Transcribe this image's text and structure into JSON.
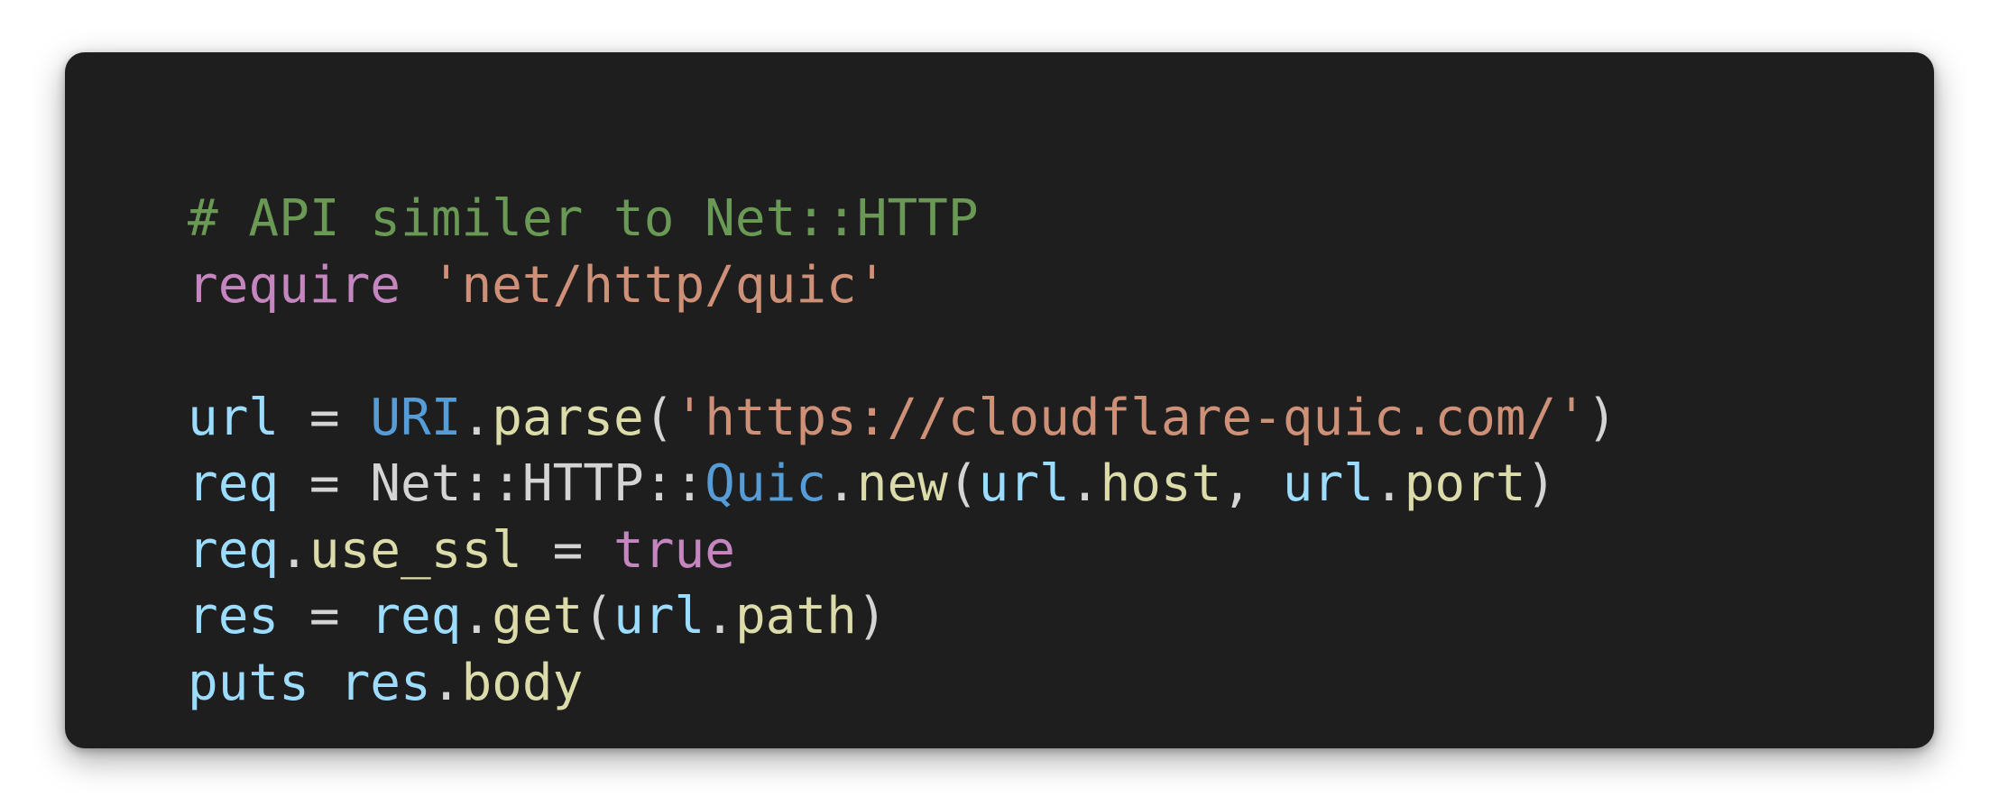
{
  "code": {
    "line1": [
      {
        "text": "# API similer to Net::HTTP",
        "color": "#6a9955"
      }
    ],
    "line2": [
      {
        "text": "require",
        "color": "#c586c0"
      },
      {
        "text": " ",
        "color": "#d4d4d4"
      },
      {
        "text": "'net/http/quic'",
        "color": "#ce9178"
      }
    ],
    "line3": [],
    "line4": [
      {
        "text": "url",
        "color": "#9cdcfe"
      },
      {
        "text": " = ",
        "color": "#d4d4d4"
      },
      {
        "text": "URI",
        "color": "#569cd6"
      },
      {
        "text": ".",
        "color": "#d4d4d4"
      },
      {
        "text": "parse",
        "color": "#dcdcaa"
      },
      {
        "text": "(",
        "color": "#d4d4d4"
      },
      {
        "text": "'https://cloudflare-quic.com/'",
        "color": "#ce9178"
      },
      {
        "text": ")",
        "color": "#d4d4d4"
      }
    ],
    "line5": [
      {
        "text": "req",
        "color": "#9cdcfe"
      },
      {
        "text": " = Net::HTTP::",
        "color": "#d4d4d4"
      },
      {
        "text": "Quic",
        "color": "#569cd6"
      },
      {
        "text": ".",
        "color": "#d4d4d4"
      },
      {
        "text": "new",
        "color": "#dcdcaa"
      },
      {
        "text": "(",
        "color": "#d4d4d4"
      },
      {
        "text": "url",
        "color": "#9cdcfe"
      },
      {
        "text": ".",
        "color": "#d4d4d4"
      },
      {
        "text": "host",
        "color": "#dcdcaa"
      },
      {
        "text": ", ",
        "color": "#d4d4d4"
      },
      {
        "text": "url",
        "color": "#9cdcfe"
      },
      {
        "text": ".",
        "color": "#d4d4d4"
      },
      {
        "text": "port",
        "color": "#dcdcaa"
      },
      {
        "text": ")",
        "color": "#d4d4d4"
      }
    ],
    "line6": [
      {
        "text": "req",
        "color": "#9cdcfe"
      },
      {
        "text": ".",
        "color": "#d4d4d4"
      },
      {
        "text": "use_ssl",
        "color": "#dcdcaa"
      },
      {
        "text": " = ",
        "color": "#d4d4d4"
      },
      {
        "text": "true",
        "color": "#c586c0"
      }
    ],
    "line7": [
      {
        "text": "res",
        "color": "#9cdcfe"
      },
      {
        "text": " = ",
        "color": "#d4d4d4"
      },
      {
        "text": "req",
        "color": "#9cdcfe"
      },
      {
        "text": ".",
        "color": "#d4d4d4"
      },
      {
        "text": "get",
        "color": "#dcdcaa"
      },
      {
        "text": "(",
        "color": "#d4d4d4"
      },
      {
        "text": "url",
        "color": "#9cdcfe"
      },
      {
        "text": ".",
        "color": "#d4d4d4"
      },
      {
        "text": "path",
        "color": "#dcdcaa"
      },
      {
        "text": ")",
        "color": "#d4d4d4"
      }
    ],
    "line8": [
      {
        "text": "puts",
        "color": "#9cdcfe"
      },
      {
        "text": " ",
        "color": "#d4d4d4"
      },
      {
        "text": "res",
        "color": "#9cdcfe"
      },
      {
        "text": ".",
        "color": "#d4d4d4"
      },
      {
        "text": "body",
        "color": "#dcdcaa"
      }
    ]
  },
  "theme": {
    "background": "#1e1e1e",
    "page": "#ffffff"
  }
}
